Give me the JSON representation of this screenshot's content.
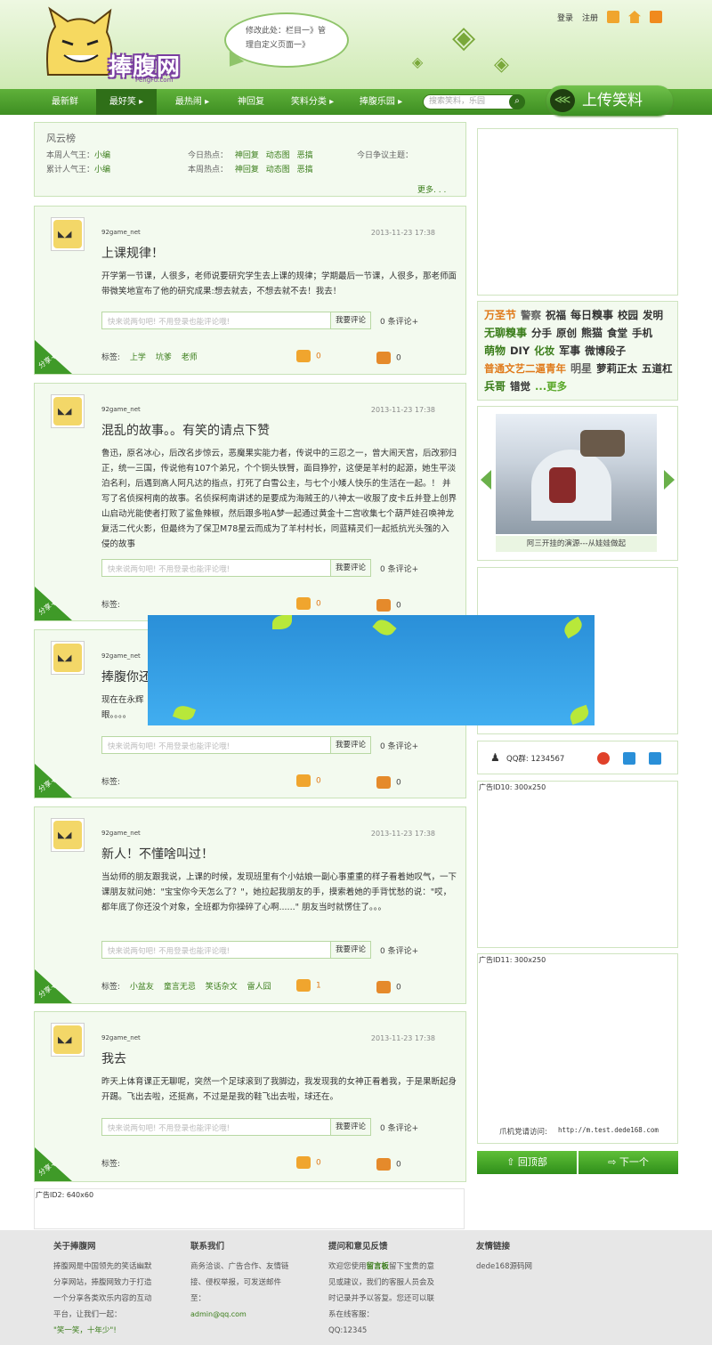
{
  "header": {
    "logo_text": "捧腹网",
    "logo_sub": "PengFu.com",
    "bubble_line1": "修改此处：栏目一》管",
    "bubble_line2": "理自定义页面一》",
    "login": "登录",
    "register": "注册"
  },
  "nav": {
    "items": [
      {
        "label": "最新鲜"
      },
      {
        "label": "最好笑 ▸"
      },
      {
        "label": "最热闹 ▸"
      },
      {
        "label": "神回复"
      },
      {
        "label": "笑料分类 ▸"
      },
      {
        "label": "捧腹乐园 ▸"
      }
    ],
    "search_placeholder": "搜索笑料，乐园",
    "upload_label": "上传笑料"
  },
  "rank": {
    "title": "风云榜",
    "week_king_label": "本周人气王：",
    "week_king": "小编",
    "total_king_label": "累计人气王：",
    "total_king": "小编",
    "today_hot_label": "今日热点：",
    "week_hot_label": "本周热点：",
    "hot_tags": [
      "神回复",
      "动态图",
      "恶搞"
    ],
    "today_debate_label": "今日争议主题：",
    "more": "更多. . ."
  },
  "posts": [
    {
      "user": "92game_net",
      "time": "2013-11-23 17:38",
      "title": "上课规律！",
      "body": "开学第一节课，人很多，老师说要研究学生去上课的规律；学期最后一节课，人很多，那老师面带微笑地宣布了他的研究成果:想去就去，不想去就不去！我去！",
      "comment_placeholder": "快来说两句吧! 不用登录也能评论哦!",
      "comment_button": "我要评论",
      "comment_count": "0 条评论+",
      "tags_label": "标签:",
      "tags": [
        "上学",
        "坑爹",
        "老师"
      ],
      "likes": "0",
      "dislikes": "0",
      "share": "分享+"
    },
    {
      "user": "92game_net",
      "time": "2013-11-23 17:38",
      "title": "混乱的故事。。有笑的请点下赞",
      "body": "鲁迅，原名冰心，后改名步惊云，恶魔果实能力者，传说中的三忍之一，曾大闹天宫，后改邪归正，统一三国，传说他有107个弟兄，个个铜头铁臂，面目狰狞，这便是羊村的起源，她生平淡泊名利，后遇到高人阿凡达的指点，打死了白雪公主，与七个小矮人快乐的生活在一起。！ 并写了名侦探柯南的故事。名侦探柯南讲述的是要成为海贼王的八神太一收服了皮卡丘并登上创界山启动光能使者打败了鲨鱼辣椒，然后跟多啦A梦一起通过黄金十二宫收集七个葫芦娃召唤神龙复活二代火影，但最终为了保卫M78星云而成为了羊村村长，同蓝精灵们一起抵抗光头强的入侵的故事",
      "comment_placeholder": "快来说两句吧! 不用登录也能评论哦!",
      "comment_button": "我要评论",
      "comment_count": "0 条评论+",
      "tags_label": "标签:",
      "tags": [],
      "likes": "0",
      "dislikes": "0",
      "share": "分享+"
    },
    {
      "user": "92game_net",
      "time": "",
      "title": "捧腹你还",
      "body": "现在在永辉\n眼。。。。",
      "comment_placeholder": "快来说两句吧! 不用登录也能评论哦!",
      "comment_button": "我要评论",
      "comment_count": "0 条评论+",
      "tags_label": "标签:",
      "tags": [],
      "likes": "0",
      "dislikes": "0",
      "share": "分享+"
    },
    {
      "user": "92game_net",
      "time": "2013-11-23 17:38",
      "title": "新人！不懂啥叫过！",
      "body": "当幼师的朋友跟我说，上课的时候，发现班里有个小姑娘一副心事重重的样子看着她叹气，一下课朋友就问她：\"宝宝你今天怎么了？\"，她拉起我朋友的手，摸索着她的手背忧愁的说：\"哎，都年底了你还没个对象，全班都为你操碎了心啊......\" 朋友当时就愣住了。。。",
      "comment_placeholder": "快来说两句吧! 不用登录也能评论哦!",
      "comment_button": "我要评论",
      "comment_count": "0 条评论+",
      "tags_label": "标签:",
      "tags": [
        "小盆友",
        "童言无忌",
        "笑话杂文",
        "雷人囧"
      ],
      "likes": "1",
      "dislikes": "0",
      "share": "分享+"
    },
    {
      "user": "92game_net",
      "time": "2013-11-23 17:38",
      "title": "我去",
      "body": "昨天上体育课正无聊呢，突然一个足球滚到了我脚边，我发现我的女神正看着我，于是果断起身开踢。飞出去啦，还挺高，不过是是我的鞋飞出去啦，球还在。",
      "comment_placeholder": "快来说两句吧! 不用登录也能评论哦!",
      "comment_button": "我要评论",
      "comment_count": "0 条评论+",
      "tags_label": "标签:",
      "tags": [],
      "likes": "0",
      "dislikes": "0",
      "share": "分享+"
    }
  ],
  "sidebar": {
    "hot_words": [
      {
        "text": "万圣节",
        "color": "#e07a1a"
      },
      {
        "text": "警察",
        "color": "#666666"
      },
      {
        "text": "祝福",
        "color": "#333333"
      },
      {
        "text": "每日糗事",
        "color": "#333333"
      },
      {
        "text": "校园",
        "color": "#333333"
      },
      {
        "text": "发明",
        "color": "#333333"
      },
      {
        "text": "无聊糗事",
        "color": "#3a7d1a"
      },
      {
        "text": "分手",
        "color": "#333333"
      },
      {
        "text": "原创",
        "color": "#333333"
      },
      {
        "text": "熊猫",
        "color": "#333333"
      },
      {
        "text": "食堂",
        "color": "#333333"
      },
      {
        "text": "手机",
        "color": "#333333"
      },
      {
        "text": "萌物",
        "color": "#3a7d1a"
      },
      {
        "text": "DIY",
        "color": "#333333"
      },
      {
        "text": "化妆",
        "color": "#3a7d1a"
      },
      {
        "text": "军事",
        "color": "#333333"
      },
      {
        "text": "微博段子",
        "color": "#333333"
      },
      {
        "text": "普通文艺二逼青年",
        "color": "#e07a1a"
      },
      {
        "text": "明星",
        "color": "#666666"
      },
      {
        "text": "萝莉正太",
        "color": "#333333"
      },
      {
        "text": "五道杠",
        "color": "#333333"
      },
      {
        "text": "兵哥",
        "color": "#3a7d1a"
      },
      {
        "text": "错觉",
        "color": "#333333"
      },
      {
        "text": "...更多",
        "color": "#5aa82a"
      }
    ],
    "slide_caption": "阿三开挂的演源---从娃娃做起",
    "qq_group": "QQ群: 1234567",
    "ad10_label": "广告ID10: 300x250",
    "ad11_label": "广告ID11: 300x250",
    "mobile_label": "爪机党请访问:",
    "mobile_url": "http://m.test.dede168.com",
    "back_top": "回顶部",
    "next": "下一个"
  },
  "ad2_label": "广告ID2: 640x60",
  "footer": {
    "about_title": "关于捧腹网",
    "about_text": "捧腹网是中国领先的笑话幽默分享网站，捧腹网致力于打造一个分享各类欢乐内容的互动平台，让我们一起：",
    "about_slogan": "\"笑一笑，十年少\"!",
    "contact_title": "联系我们",
    "contact_text": "商务洽谈、广告合作、友情链接、侵权举报，可发送邮件至：",
    "contact_email": "admin@qq.com",
    "feedback_title": "提问和意见反馈",
    "feedback_text_pre": "欢迎您使用",
    "feedback_link": "留言板",
    "feedback_text_post": "留下宝贵的意见或建议，我们的客服人员会及时记录并予以答复。您还可以联系在线客服：",
    "feedback_qq": "QQ:12345",
    "links_title": "友情链接",
    "links": [
      "dede168源码网"
    ]
  },
  "colors": {
    "brand_green": "#3e8e22",
    "panel_bg": "#f3faef",
    "accent_orange": "#e07a1a",
    "ad_blue": "#2a8fd8"
  }
}
